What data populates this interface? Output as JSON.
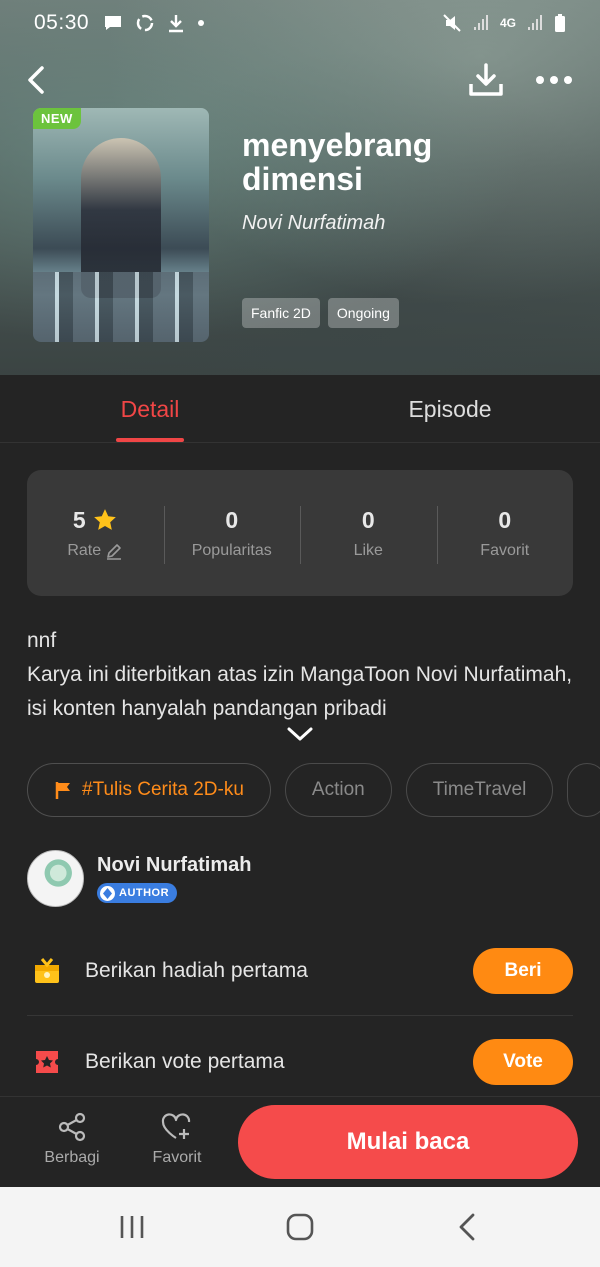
{
  "status_bar": {
    "time": "05:30",
    "network": "4G"
  },
  "book": {
    "title": "menyebrang dimensi",
    "author": "Novi Nurfatimah",
    "badge": "NEW",
    "genre_tags": [
      "Fanfic 2D",
      "Ongoing"
    ]
  },
  "tabs": [
    {
      "label": "Detail",
      "active": true
    },
    {
      "label": "Episode",
      "active": false
    }
  ],
  "stats": [
    {
      "value": "5",
      "label": "Rate"
    },
    {
      "value": "0",
      "label": "Popularitas"
    },
    {
      "value": "0",
      "label": "Like"
    },
    {
      "value": "0",
      "label": "Favorit"
    }
  ],
  "description": {
    "line1": "nnf",
    "line2": "Karya ini diterbitkan atas izin MangaToon Novi Nurfatimah, isi konten hanyalah pandangan pribadi"
  },
  "chips": [
    "#Tulis Cerita 2D-ku",
    "Action",
    "TimeTravel"
  ],
  "author_info": {
    "name": "Novi Nurfatimah",
    "badge": "AUTHOR"
  },
  "actions": {
    "gift": {
      "text": "Berikan hadiah pertama",
      "button": "Beri"
    },
    "vote": {
      "text": "Berikan vote pertama",
      "button": "Vote"
    }
  },
  "bottom_bar": {
    "share": "Berbagi",
    "favorite": "Favorit",
    "read": "Mulai baca"
  },
  "colors": {
    "accent": "#f04646",
    "orange": "#ff8a12",
    "read_button": "#f54b4b",
    "background": "#242424"
  }
}
